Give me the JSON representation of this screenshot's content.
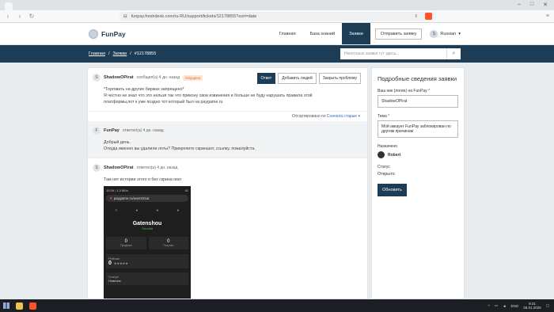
{
  "browser": {
    "url": "funpay.freshdesk.com/ru-RU/support/tickets/12178855?sort=date"
  },
  "site": {
    "brand": "FunPay",
    "nav": [
      "Главная",
      "База знаний",
      "Заявки"
    ],
    "submit_button": "Отправить заявку",
    "user_initial": "S",
    "language": "Russian"
  },
  "breadcrumb": {
    "home": "Главная",
    "tickets": "Заявки",
    "current": "#12178855",
    "search_placeholder": "Некоторые заявки тут здесь..."
  },
  "messages": [
    {
      "initial": "S",
      "author": "ShadowOPirat",
      "meta": "сообщил(а) 4 дн. назад",
      "badge": "Опущено",
      "body_line1": "*Торговать на других биржах запрещено*",
      "body_line2": "Я честно не знал что это нельзя так что прикону свои извинения и больше не буду нарушать правила этой",
      "body_line3": "платформы,пот к уже поздно тот который был на paygame.ru"
    },
    {
      "initial": "F",
      "author": "FunPay",
      "meta": "ответил(а) 4 дн. назад",
      "body_line1": "Добрый день.",
      "body_line2": "Откуда именно вы удалили лоты? Прикрепите скриншот, ссылку, пожалуйста."
    },
    {
      "initial": "S",
      "author": "ShadowOPirat",
      "meta": "ответил(а) 4 дн. назад",
      "body_line1": "Там нет истории этого я без скрина омл"
    }
  ],
  "actions": {
    "reply": "Ответ",
    "add_people": "Добавить людей",
    "close": "Закрыть проблему"
  },
  "sort": {
    "label": "Отсортировано по",
    "value": "Сначала старые"
  },
  "phone": {
    "time": "10:26 ¦ 1,3 КБ/с",
    "battery": "41",
    "url": "paygame.ru/users/Gat",
    "name": "Gatenshou",
    "status": "Онлайн",
    "stat_left_value": "0",
    "stat_left_label": "Продажи",
    "stat_right_value": "0",
    "stat_right_label": "Покупки",
    "rating_label": "Рейтинг",
    "rating_value": "0",
    "status_label": "Статус",
    "status_value": "Новичок"
  },
  "details": {
    "title": "Подробные сведения заявки",
    "nick_label": "Ваш ник (логин) на FunPay",
    "nick_value": "ShadowOPirat",
    "subject_label": "Тема",
    "subject_value": "Мой аккаунт FunPay заблокирован по другим причинам",
    "assignee_label": "Назначено",
    "assignee_name": "Robert",
    "status_label": "Статус",
    "status_value": "Открыто",
    "update_button": "Обновить"
  },
  "taskbar": {
    "lang": "ENG",
    "time": "9:31",
    "date": "25.01.2025"
  },
  "colors": {
    "brand_dark": "#1c3d55",
    "badge_orange": "#d9702a"
  }
}
